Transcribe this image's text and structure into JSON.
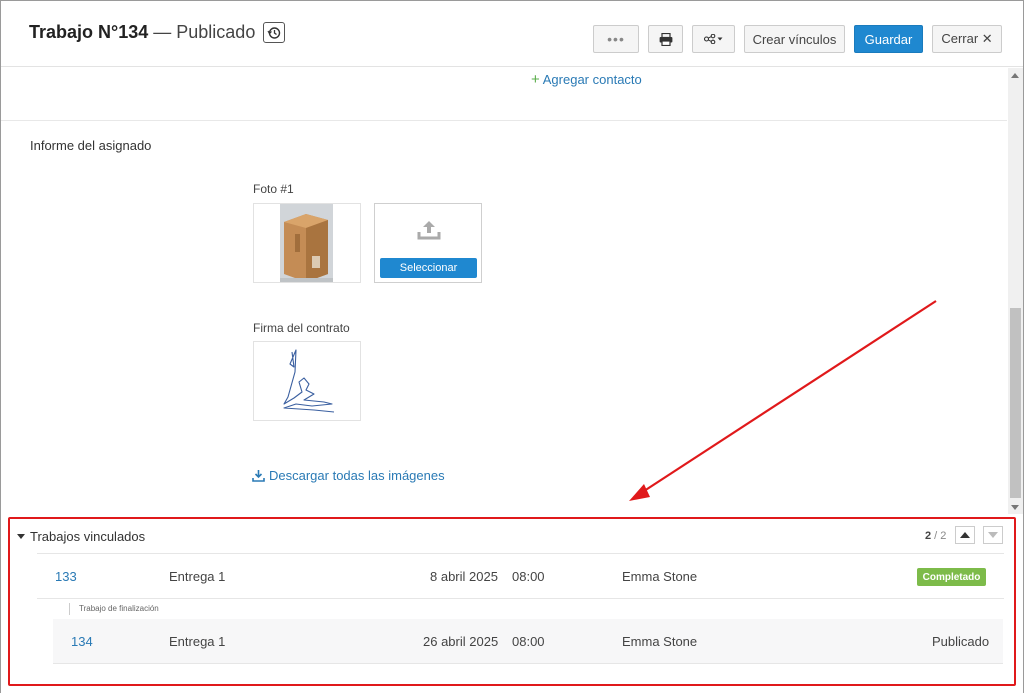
{
  "header": {
    "title": "Trabajo N°134",
    "separator": "—",
    "status": "Publicado",
    "buttons": {
      "more": "•••",
      "create_links": "Crear vínculos",
      "save": "Guardar",
      "close": "Cerrar ✕"
    }
  },
  "content": {
    "add_contact": "Agregar contacto",
    "section_title": "Informe del asignado",
    "photo_label": "Foto #1",
    "select_button": "Seleccionar",
    "signature_label": "Firma del contrato",
    "download_all": "Descargar todas las imágenes"
  },
  "linked_jobs": {
    "title": "Trabajos vinculados",
    "pager_current": "2",
    "pager_sep": " / ",
    "pager_total": "2",
    "rows": [
      {
        "id": "133",
        "type": "Entrega 1",
        "date": "8 abril 2025",
        "time": "08:00",
        "assignee": "Emma Stone",
        "status": "Completado"
      },
      {
        "id": "134",
        "type": "Entrega 1",
        "date": "26 abril 2025",
        "time": "08:00",
        "assignee": "Emma Stone",
        "status": "Publicado"
      }
    ],
    "sub_label": "Trabajo de finalización"
  },
  "colors": {
    "primary": "#1f88d0",
    "link": "#2a7ab5",
    "completed": "#7dbb4a",
    "annotation": "#e0191b"
  }
}
